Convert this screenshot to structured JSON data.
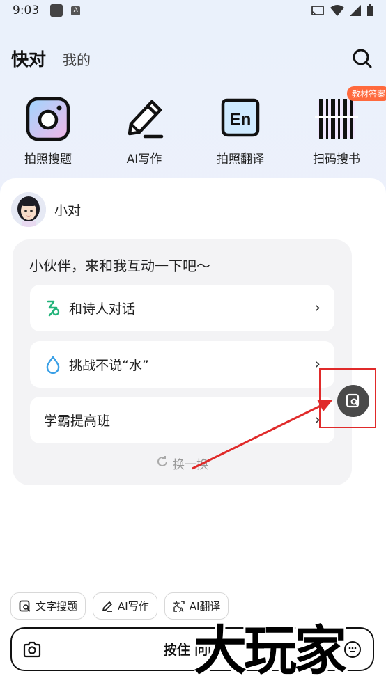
{
  "status_bar": {
    "time": "9:03",
    "a_badge": "A"
  },
  "nav": {
    "tab_main": "快对",
    "tab_mine": "我的"
  },
  "tools": [
    {
      "label": "拍照搜题",
      "icon": "camera-icon"
    },
    {
      "label": "AI写作",
      "icon": "pencil-icon"
    },
    {
      "label": "拍照翻译",
      "icon": "translate-icon"
    },
    {
      "label": "扫码搜书",
      "icon": "barcode-icon",
      "badge": "教材答案"
    }
  ],
  "bot": {
    "name": "小对"
  },
  "card": {
    "title": "小伙伴，来和我互动一下吧～",
    "options": [
      {
        "label": "和诗人对话",
        "icon": "poet-icon"
      },
      {
        "label": "挑战不说“水”",
        "icon": "water-drop-icon"
      },
      {
        "label": "学霸提高班",
        "icon": ""
      }
    ],
    "refresh_label": "换一换"
  },
  "chips": [
    {
      "label": "文字搜题",
      "icon": "text-search-icon"
    },
    {
      "label": "AI写作",
      "icon": "pen-icon"
    },
    {
      "label": "AI翻译",
      "icon": "translate-small-icon"
    }
  ],
  "input_bar": {
    "hold_label": "按住 问问"
  },
  "watermark": "大玩家",
  "colors": {
    "accent_badge": "#ff6a3d",
    "highlight": "#e02a2a",
    "poet_green": "#22b37a",
    "drop_blue": "#3aa0e6"
  }
}
